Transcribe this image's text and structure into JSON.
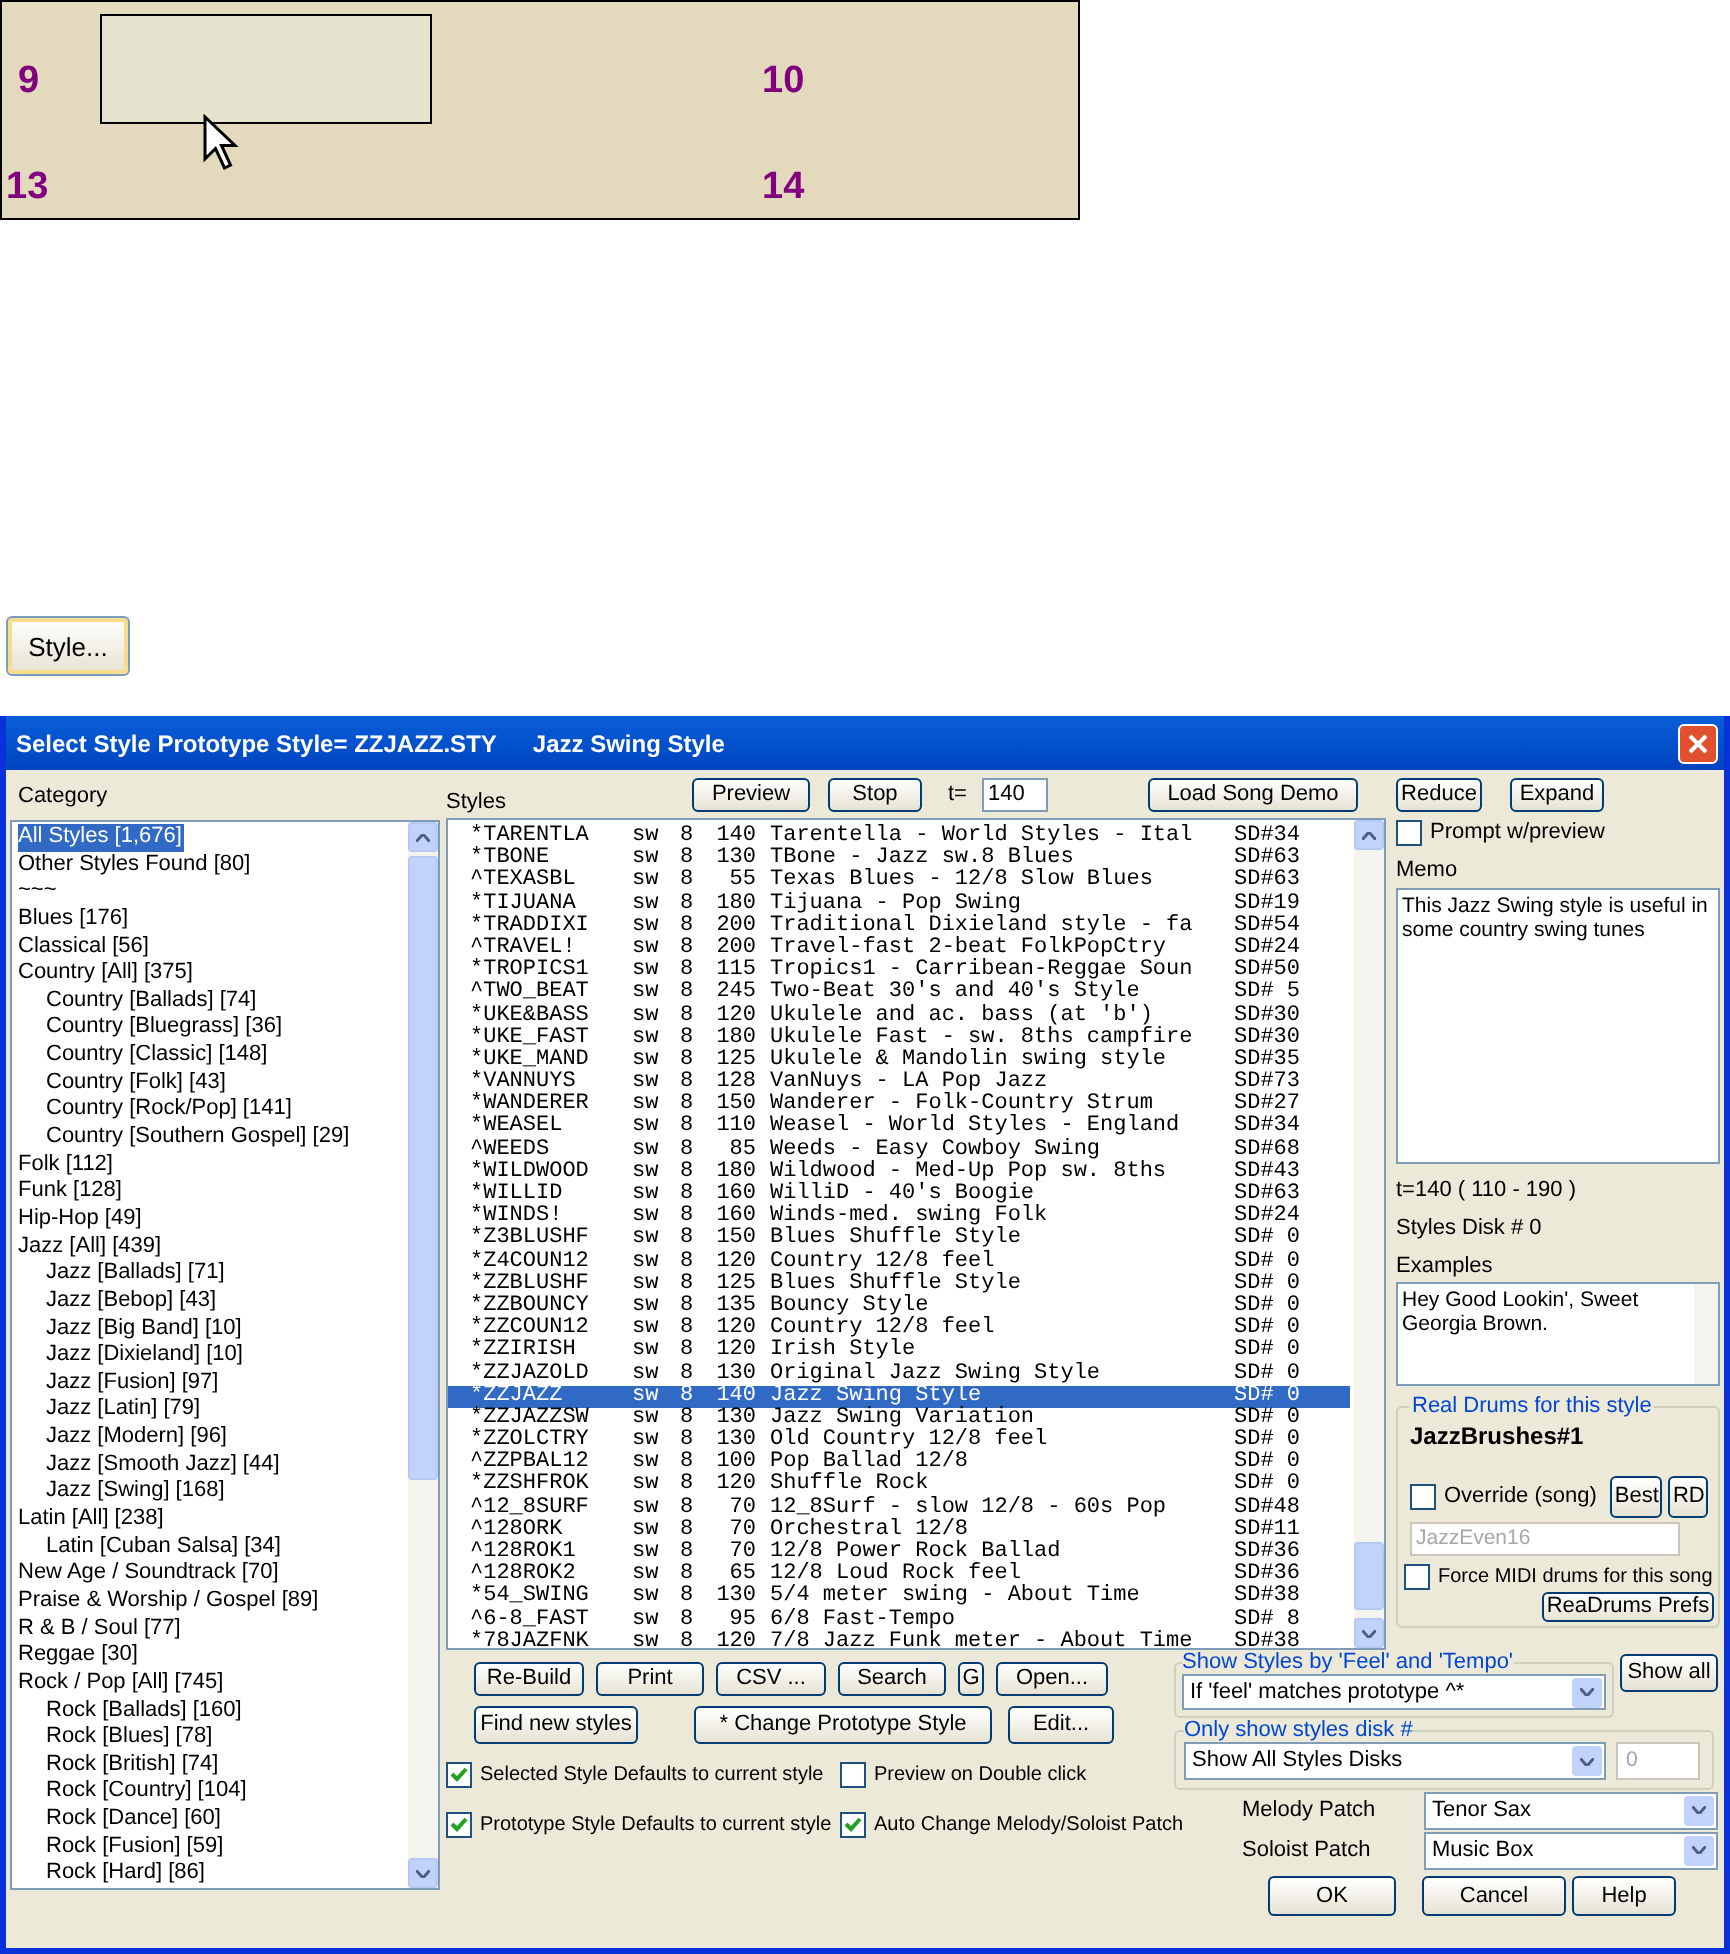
{
  "canvas": {
    "bars": [
      {
        "number": "9"
      },
      {
        "number": "10"
      },
      {
        "number": "13"
      },
      {
        "number": "14"
      }
    ]
  },
  "style_button": {
    "label": "Style..."
  },
  "dialog": {
    "title": "Select Style Prototype Style= ZZJAZZ.STY",
    "subtitle": "Jazz Swing Style",
    "category": {
      "label": "Category",
      "items": [
        {
          "label": "All Styles [1,676]",
          "selected": true
        },
        {
          "label": "Other Styles Found [80]",
          "selected": false
        },
        {
          "label": "~~~",
          "selected": false
        },
        {
          "label": "Blues [176]",
          "selected": false
        },
        {
          "label": "Classical [56]",
          "selected": false
        },
        {
          "label": "Country [All] [375]",
          "selected": false,
          "children": [
            {
              "label": "Country [Ballads] [74]",
              "selected": false
            },
            {
              "label": "Country [Bluegrass] [36]",
              "selected": false
            },
            {
              "label": "Country [Classic] [148]",
              "selected": false
            },
            {
              "label": "Country [Folk] [43]",
              "selected": false
            },
            {
              "label": "Country [Rock/Pop] [141]",
              "selected": false
            },
            {
              "label": "Country [Southern Gospel] [29]",
              "selected": false
            }
          ]
        },
        {
          "label": "Folk [112]",
          "selected": false
        },
        {
          "label": "Funk [128]",
          "selected": false
        },
        {
          "label": "Hip-Hop [49]",
          "selected": false
        },
        {
          "label": "Jazz [All] [439]",
          "selected": false,
          "children": [
            {
              "label": "Jazz [Ballads] [71]",
              "selected": false
            },
            {
              "label": "Jazz [Bebop] [43]",
              "selected": false
            },
            {
              "label": "Jazz [Big Band] [10]",
              "selected": false
            },
            {
              "label": "Jazz [Dixieland] [10]",
              "selected": false
            },
            {
              "label": "Jazz [Fusion] [97]",
              "selected": false
            },
            {
              "label": "Jazz [Latin] [79]",
              "selected": false
            },
            {
              "label": "Jazz [Modern] [96]",
              "selected": false
            },
            {
              "label": "Jazz [Smooth Jazz] [44]",
              "selected": false
            },
            {
              "label": "Jazz [Swing] [168]",
              "selected": false
            }
          ]
        },
        {
          "label": "Latin [All] [238]",
          "selected": false,
          "children": [
            {
              "label": "Latin [Cuban Salsa] [34]",
              "selected": false
            }
          ]
        },
        {
          "label": "New Age / Soundtrack [70]",
          "selected": false
        },
        {
          "label": "Praise & Worship / Gospel [89]",
          "selected": false
        },
        {
          "label": "R & B / Soul [77]",
          "selected": false
        },
        {
          "label": "Reggae [30]",
          "selected": false
        },
        {
          "label": "Rock / Pop [All] [745]",
          "selected": false,
          "children": [
            {
              "label": "Rock [Ballads] [160]",
              "selected": false
            },
            {
              "label": "Rock [Blues] [78]",
              "selected": false
            },
            {
              "label": "Rock [British] [74]",
              "selected": false
            },
            {
              "label": "Rock [Country] [104]",
              "selected": false
            },
            {
              "label": "Rock [Dance] [60]",
              "selected": false
            },
            {
              "label": "Rock [Fusion] [59]",
              "selected": false
            },
            {
              "label": "Rock [Hard] [86]",
              "selected": false
            }
          ]
        }
      ]
    },
    "styles": {
      "label": "Styles",
      "buttons": [
        "Preview",
        "Stop"
      ],
      "tempo_label": "t=",
      "tempo": "140",
      "demo_button": "Load Song Demo",
      "rows": [
        {
          "name": "*TARENTLA",
          "feel": "sw",
          "beats": "8",
          "tempo": "140",
          "description": "Tarentella - World Styles - Ital",
          "disk": "SD#34",
          "selected": false
        },
        {
          "name": "*TBONE",
          "feel": "sw",
          "beats": "8",
          "tempo": "130",
          "description": "TBone - Jazz sw.8 Blues",
          "disk": "SD#63",
          "selected": false
        },
        {
          "name": "^TEXASBL",
          "feel": "sw",
          "beats": "8",
          "tempo": "55",
          "description": "Texas Blues - 12/8 Slow Blues",
          "disk": "SD#63",
          "selected": false
        },
        {
          "name": "*TIJUANA",
          "feel": "sw",
          "beats": "8",
          "tempo": "180",
          "description": "Tijuana - Pop Swing",
          "disk": "SD#19",
          "selected": false
        },
        {
          "name": "*TRADDIXI",
          "feel": "sw",
          "beats": "8",
          "tempo": "200",
          "description": "Traditional Dixieland style - fa",
          "disk": "SD#54",
          "selected": false
        },
        {
          "name": "^TRAVEL!",
          "feel": "sw",
          "beats": "8",
          "tempo": "200",
          "description": "Travel-fast 2-beat FolkPopCtry",
          "disk": "SD#24",
          "selected": false
        },
        {
          "name": "*TROPICS1",
          "feel": "sw",
          "beats": "8",
          "tempo": "115",
          "description": "Tropics1 - Carribean-Reggae Soun",
          "disk": "SD#50",
          "selected": false
        },
        {
          "name": "^TWO_BEAT",
          "feel": "sw",
          "beats": "8",
          "tempo": "245",
          "description": "Two-Beat 30's and 40's Style",
          "disk": "SD# 5",
          "selected": false
        },
        {
          "name": "*UKE&BASS",
          "feel": "sw",
          "beats": "8",
          "tempo": "120",
          "description": "Ukulele and ac. bass (at 'b')",
          "disk": "SD#30",
          "selected": false
        },
        {
          "name": "*UKE_FAST",
          "feel": "sw",
          "beats": "8",
          "tempo": "180",
          "description": "Ukulele Fast - sw. 8ths campfire",
          "disk": "SD#30",
          "selected": false
        },
        {
          "name": "*UKE_MAND",
          "feel": "sw",
          "beats": "8",
          "tempo": "125",
          "description": "Ukulele & Mandolin swing style",
          "disk": "SD#35",
          "selected": false
        },
        {
          "name": "*VANNUYS",
          "feel": "sw",
          "beats": "8",
          "tempo": "128",
          "description": "VanNuys - LA Pop Jazz",
          "disk": "SD#73",
          "selected": false
        },
        {
          "name": "*WANDERER",
          "feel": "sw",
          "beats": "8",
          "tempo": "150",
          "description": "Wanderer - Folk-Country Strum",
          "disk": "SD#27",
          "selected": false
        },
        {
          "name": "*WEASEL",
          "feel": "sw",
          "beats": "8",
          "tempo": "110",
          "description": "Weasel - World Styles - England",
          "disk": "SD#34",
          "selected": false
        },
        {
          "name": "^WEEDS",
          "feel": "sw",
          "beats": "8",
          "tempo": "85",
          "description": "Weeds - Easy Cowboy Swing",
          "disk": "SD#68",
          "selected": false
        },
        {
          "name": "*WILDWOOD",
          "feel": "sw",
          "beats": "8",
          "tempo": "180",
          "description": "Wildwood - Med-Up Pop sw. 8ths",
          "disk": "SD#43",
          "selected": false
        },
        {
          "name": "*WILLID",
          "feel": "sw",
          "beats": "8",
          "tempo": "160",
          "description": "WilliD - 40's Boogie",
          "disk": "SD#63",
          "selected": false
        },
        {
          "name": "*WINDS!",
          "feel": "sw",
          "beats": "8",
          "tempo": "160",
          "description": "Winds-med. swing Folk",
          "disk": "SD#24",
          "selected": false
        },
        {
          "name": "*Z3BLUSHF",
          "feel": "sw",
          "beats": "8",
          "tempo": "150",
          "description": "Blues Shuffle Style",
          "disk": "SD# 0",
          "selected": false
        },
        {
          "name": "*Z4COUN12",
          "feel": "sw",
          "beats": "8",
          "tempo": "120",
          "description": "Country 12/8 feel",
          "disk": "SD# 0",
          "selected": false
        },
        {
          "name": "*ZZBLUSHF",
          "feel": "sw",
          "beats": "8",
          "tempo": "125",
          "description": "Blues Shuffle Style",
          "disk": "SD# 0",
          "selected": false
        },
        {
          "name": "*ZZBOUNCY",
          "feel": "sw",
          "beats": "8",
          "tempo": "135",
          "description": "Bouncy Style",
          "disk": "SD# 0",
          "selected": false
        },
        {
          "name": "*ZZCOUN12",
          "feel": "sw",
          "beats": "8",
          "tempo": "120",
          "description": "Country 12/8 feel",
          "disk": "SD# 0",
          "selected": false
        },
        {
          "name": "*ZZIRISH",
          "feel": "sw",
          "beats": "8",
          "tempo": "120",
          "description": "Irish Style",
          "disk": "SD# 0",
          "selected": false
        },
        {
          "name": "*ZZJAZOLD",
          "feel": "sw",
          "beats": "8",
          "tempo": "130",
          "description": "Original Jazz Swing Style",
          "disk": "SD# 0",
          "selected": false
        },
        {
          "name": "*ZZJAZZ",
          "feel": "sw",
          "beats": "8",
          "tempo": "140",
          "description": "Jazz Swing Style",
          "disk": "SD# 0",
          "selected": true
        },
        {
          "name": "*ZZJAZZSW",
          "feel": "sw",
          "beats": "8",
          "tempo": "130",
          "description": "Jazz Swing Variation",
          "disk": "SD# 0",
          "selected": false
        },
        {
          "name": "*ZZOLCTRY",
          "feel": "sw",
          "beats": "8",
          "tempo": "130",
          "description": "Old Country 12/8 feel",
          "disk": "SD# 0",
          "selected": false
        },
        {
          "name": "^ZZPBAL12",
          "feel": "sw",
          "beats": "8",
          "tempo": "100",
          "description": "Pop Ballad 12/8",
          "disk": "SD# 0",
          "selected": false
        },
        {
          "name": "*ZZSHFROK",
          "feel": "sw",
          "beats": "8",
          "tempo": "120",
          "description": "Shuffle Rock",
          "disk": "SD# 0",
          "selected": false
        },
        {
          "name": "^12_8SURF",
          "feel": "sw",
          "beats": "8",
          "tempo": "70",
          "description": "12_8Surf - slow 12/8 - 60s Pop",
          "disk": "SD#48",
          "selected": false
        },
        {
          "name": "^128ORK",
          "feel": "sw",
          "beats": "8",
          "tempo": "70",
          "description": "Orchestral 12/8",
          "disk": "SD#11",
          "selected": false
        },
        {
          "name": "^128ROK1",
          "feel": "sw",
          "beats": "8",
          "tempo": "70",
          "description": "12/8 Power Rock Ballad",
          "disk": "SD#36",
          "selected": false
        },
        {
          "name": "^128ROK2",
          "feel": "sw",
          "beats": "8",
          "tempo": "65",
          "description": "12/8 Loud Rock feel",
          "disk": "SD#36",
          "selected": false
        },
        {
          "name": "*54_SWING",
          "feel": "sw",
          "beats": "8",
          "tempo": "130",
          "description": "5/4 meter swing - About Time",
          "disk": "SD#38",
          "selected": false
        },
        {
          "name": "^6-8_FAST",
          "feel": "sw",
          "beats": "8",
          "tempo": "95",
          "description": "6/8 Fast-Tempo",
          "disk": "SD# 8",
          "selected": false
        },
        {
          "name": "*78JAZFNK",
          "feel": "sw",
          "beats": "8",
          "tempo": "120",
          "description": "7/8 Jazz Funk meter - About Time",
          "disk": "SD#38",
          "selected": false
        }
      ]
    },
    "actions": {
      "row1": [
        "Re-Build",
        "Print",
        "CSV ...",
        "Search",
        "G",
        "Open..."
      ],
      "row2": [
        "Find new styles",
        "* Change Prototype Style",
        "Edit..."
      ]
    },
    "options": [
      {
        "label": "Selected Style Defaults to current style",
        "checked": true
      },
      {
        "label": "Preview on Double click",
        "checked": false
      },
      {
        "label": "Prototype Style Defaults to current style",
        "checked": true
      },
      {
        "label": "Auto Change Melody/Soloist Patch",
        "checked": true
      }
    ],
    "side": {
      "buttons": [
        "Reduce",
        "Expand"
      ],
      "prompt": {
        "label": "Prompt w/preview",
        "checked": false
      },
      "memo_label": "Memo",
      "memo": "This Jazz Swing style is useful in some country swing tunes",
      "tempo_range": "t=140 ( 110 - 190 )",
      "disk": "Styles Disk # 0",
      "examples_label": "Examples",
      "examples": "Hey Good Lookin', Sweet Georgia Brown.",
      "drums": {
        "title": "Real Drums for this style",
        "name": "JazzBrushes#1",
        "override": {
          "label": "Override (song)",
          "checked": false
        },
        "buttons": [
          "Best",
          "RD"
        ],
        "field": "JazzEven16",
        "force": {
          "label": "Force MIDI drums for this song",
          "checked": false
        },
        "prefs_button": "ReaDrums Prefs"
      }
    },
    "filters": {
      "feel": {
        "title": "Show Styles by 'Feel' and 'Tempo'",
        "value": "If 'feel' matches prototype ^*"
      },
      "show_all": "Show all",
      "disk": {
        "title": "Only show styles disk #",
        "value": "Show All Styles Disks",
        "number": "0"
      }
    },
    "patches": [
      {
        "label": "Melody Patch",
        "value": "Tenor Sax"
      },
      {
        "label": "Soloist Patch",
        "value": "Music Box"
      }
    ],
    "footer": [
      "OK",
      "Cancel",
      "Help"
    ]
  }
}
